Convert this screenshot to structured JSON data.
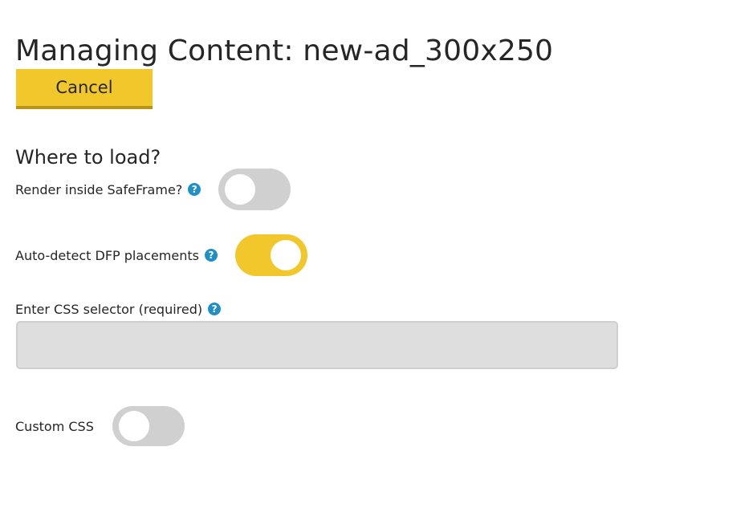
{
  "header": {
    "title": "Managing Content: new-ad_300x250"
  },
  "actions": {
    "cancel_label": "Cancel"
  },
  "section": {
    "title": "Where to load?"
  },
  "settings": {
    "safeframe": {
      "label": "Render inside SafeFrame?",
      "help_icon": "question-circle-icon",
      "enabled": false
    },
    "auto_detect": {
      "label": "Auto-detect DFP placements",
      "help_icon": "question-circle-icon",
      "enabled": true
    },
    "css_selector": {
      "label": "Enter CSS selector (required)",
      "help_icon": "question-circle-icon",
      "value": "",
      "placeholder": ""
    },
    "custom_css": {
      "label": "Custom CSS",
      "enabled": false
    }
  },
  "icons": {
    "help_glyph": "?"
  },
  "colors": {
    "accent": "#f2c72c",
    "accent_dark": "#b89414",
    "toggle_off": "#d0d0d0",
    "help_icon": "#1f8fc7",
    "input_bg": "#dedede",
    "text": "#262626"
  }
}
